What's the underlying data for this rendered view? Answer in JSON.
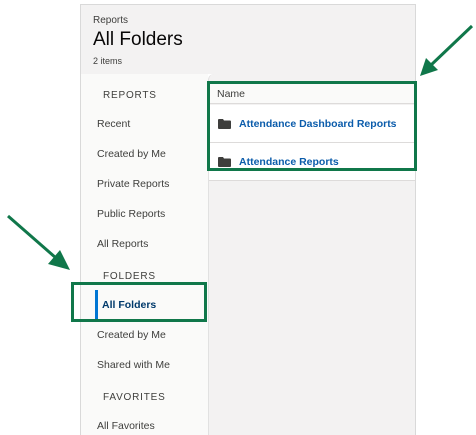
{
  "header": {
    "breadcrumb": "Reports",
    "title": "All Folders",
    "count": "2 items"
  },
  "sidebar": {
    "reports_heading": "REPORTS",
    "reports_items": [
      {
        "label": "Recent"
      },
      {
        "label": "Created by Me"
      },
      {
        "label": "Private Reports"
      },
      {
        "label": "Public Reports"
      },
      {
        "label": "All Reports"
      }
    ],
    "folders_heading": "FOLDERS",
    "folders_items": [
      {
        "label": "All Folders",
        "active": true
      },
      {
        "label": "Created by Me"
      },
      {
        "label": "Shared with Me"
      }
    ],
    "favorites_heading": "FAVORITES",
    "favorites_items": [
      {
        "label": "All Favorites"
      }
    ]
  },
  "table": {
    "column_header": "Name",
    "rows": [
      {
        "name": "Attendance Dashboard Reports",
        "icon": "folder-icon"
      },
      {
        "name": "Attendance Reports",
        "icon": "folder-icon"
      }
    ]
  },
  "colors": {
    "highlight": "#10774a",
    "link": "#0b5cab",
    "active_bar": "#0176d3"
  }
}
